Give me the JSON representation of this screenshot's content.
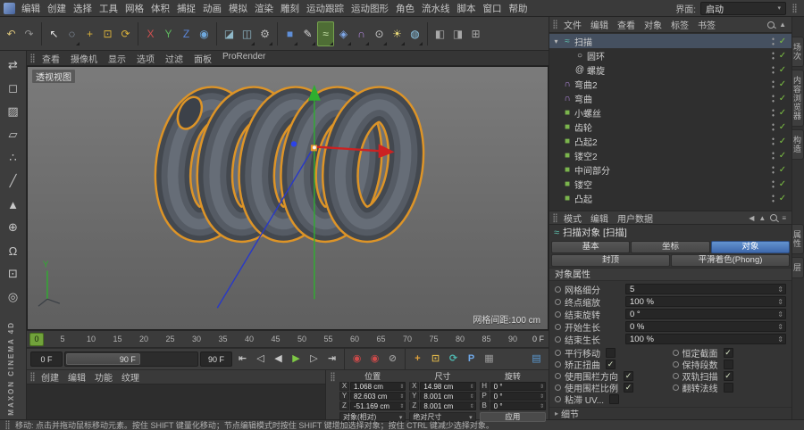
{
  "app": {
    "interface_label": "界面:",
    "interface_value": "启动"
  },
  "icons": {
    "check": "✓",
    "expander": "▾",
    "stepper": "⇕",
    "chevron_down": "▾",
    "triangle_right": "▸",
    "back": "◀",
    "up": "▲",
    "menu": "≡"
  },
  "menubar": {
    "items": [
      "编辑",
      "创建",
      "选择",
      "工具",
      "网格",
      "体积",
      "捕捉",
      "动画",
      "模拟",
      "渲染",
      "雕刻",
      "运动跟踪",
      "运动图形",
      "角色",
      "流水线",
      "脚本",
      "窗口",
      "帮助"
    ]
  },
  "toolbar": {
    "icons": [
      {
        "name": "undo",
        "glyph": "↶",
        "color": "#d9c37a"
      },
      {
        "name": "redo",
        "glyph": "↷",
        "color": "#909090"
      },
      {
        "sep": true
      },
      {
        "name": "live-selection",
        "glyph": "↖",
        "color": "#e6e6e6"
      },
      {
        "name": "selection-frame",
        "glyph": "◌",
        "color": "#b8cde8",
        "corner": true
      },
      {
        "name": "move-tool",
        "glyph": "+",
        "color": "#d9b13b"
      },
      {
        "name": "scale-tool",
        "glyph": "⊡",
        "color": "#d9b13b"
      },
      {
        "name": "rotate-tool",
        "glyph": "⟳",
        "color": "#d9b13b"
      },
      {
        "sep": true
      },
      {
        "name": "lock-x-axis",
        "glyph": "X",
        "color": "#d05050"
      },
      {
        "name": "lock-y-axis",
        "glyph": "Y",
        "color": "#5fb85f"
      },
      {
        "name": "lock-z-axis",
        "glyph": "Z",
        "color": "#5b86d8"
      },
      {
        "name": "coordinate-system",
        "glyph": "◉",
        "color": "#6fa8dc"
      },
      {
        "sep": true
      },
      {
        "name": "render-view",
        "glyph": "◪",
        "color": "#8fb8c8"
      },
      {
        "name": "render-picture-viewer",
        "glyph": "◫",
        "color": "#8fb8c8",
        "corner": true
      },
      {
        "name": "render-settings",
        "glyph": "⚙",
        "color": "#bababa",
        "corner": true
      },
      {
        "sep": true
      },
      {
        "name": "add-primitive-cube",
        "glyph": "■",
        "color": "#5f8fd8",
        "corner": true
      },
      {
        "name": "spline-pen",
        "glyph": "✎",
        "color": "#d8d8d8",
        "corner": true
      },
      {
        "name": "sweep-generator",
        "glyph": "≈",
        "color": "#cde8b0",
        "corner": true,
        "active": true
      },
      {
        "name": "subdivision-surface",
        "glyph": "◈",
        "color": "#7fa8e8",
        "corner": true
      },
      {
        "name": "bend-deformer",
        "glyph": "∩",
        "color": "#b48ae0",
        "corner": true
      },
      {
        "name": "camera",
        "glyph": "⊙",
        "color": "#c8c8c8",
        "corner": true
      },
      {
        "name": "light",
        "glyph": "☀",
        "color": "#e8d878",
        "corner": true
      },
      {
        "name": "sky",
        "glyph": "◍",
        "color": "#8fc8e8",
        "corner": true
      },
      {
        "sep": true
      },
      {
        "name": "layout-one",
        "glyph": "◧",
        "color": "#a8a8a8"
      },
      {
        "name": "layout-two",
        "glyph": "◨",
        "color": "#a8a8a8"
      },
      {
        "name": "layout-quad",
        "glyph": "⊞",
        "color": "#a8a8a8"
      }
    ]
  },
  "left_toolbar": {
    "brand": "MAXON CINEMA 4D",
    "icons": [
      {
        "name": "make-editable",
        "glyph": "⇄",
        "color": "#c8c8c8"
      },
      {
        "name": "model-mode",
        "glyph": "◻",
        "color": "#c8c8c8"
      },
      {
        "name": "texture-mode",
        "glyph": "▨",
        "color": "#c8c8c8"
      },
      {
        "name": "workplane-mode",
        "glyph": "▱",
        "color": "#c8c8c8"
      },
      {
        "name": "points-mode",
        "glyph": "∴",
        "color": "#c8c8c8"
      },
      {
        "name": "edges-mode",
        "glyph": "╱",
        "color": "#c8c8c8"
      },
      {
        "name": "polygons-mode",
        "glyph": "▲",
        "color": "#c8c8c8"
      },
      {
        "name": "axis-mode",
        "glyph": "⊕",
        "color": "#c8c8c8"
      },
      {
        "name": "snap-toggle",
        "glyph": "Ω",
        "color": "#c8c8c8"
      },
      {
        "name": "workplane-lock",
        "glyph": "⊡",
        "color": "#c8c8c8"
      },
      {
        "name": "viewport-filter",
        "glyph": "◎",
        "color": "#c8c8c8"
      }
    ]
  },
  "viewport": {
    "menu": [
      "查看",
      "摄像机",
      "显示",
      "选项",
      "过滤",
      "面板",
      "ProRender"
    ],
    "view_label": "透视视图",
    "grid_label": "网格间距:100 cm"
  },
  "timeline": {
    "ticks": [
      "0",
      "5",
      "10",
      "15",
      "20",
      "25",
      "30",
      "35",
      "40",
      "45",
      "50",
      "55",
      "60",
      "65",
      "70",
      "75",
      "80",
      "85",
      "90"
    ],
    "playhead": "0",
    "current_frame": "0 F"
  },
  "transport": {
    "current": "0 F",
    "range_handle": "90 F",
    "range_end": "90 F",
    "buttons": [
      {
        "name": "goto-start",
        "glyph": "⇤",
        "color": "#c8c8c8"
      },
      {
        "name": "previous-key",
        "glyph": "◁",
        "color": "#c8c8c8"
      },
      {
        "name": "previous-frame",
        "glyph": "◀",
        "color": "#c8c8c8"
      },
      {
        "name": "play",
        "glyph": "▶",
        "color": "#7ec845"
      },
      {
        "name": "next-frame",
        "glyph": "▷",
        "color": "#c8c8c8"
      },
      {
        "name": "goto-end",
        "glyph": "⇥",
        "color": "#c8c8c8"
      },
      {
        "sep": true
      },
      {
        "name": "record-keyframe",
        "glyph": "◉",
        "color": "#cf4a4a"
      },
      {
        "name": "autokeying",
        "glyph": "◉",
        "color": "#cf4a4a"
      },
      {
        "name": "keyframe-off",
        "glyph": "⊘",
        "color": "#9a9a9a"
      },
      {
        "sep": true
      },
      {
        "name": "key-position",
        "glyph": "+",
        "color": "#e0a23c"
      },
      {
        "name": "key-scale",
        "glyph": "⊡",
        "color": "#d8b14a"
      },
      {
        "name": "key-rotation",
        "glyph": "⟳",
        "color": "#4fb8b0"
      },
      {
        "name": "key-parameter",
        "glyph": "P",
        "color": "#6fa8e8"
      },
      {
        "name": "key-pla",
        "glyph": "▦",
        "color": "#9a9a9a"
      },
      {
        "name": "preview-render",
        "glyph": "▤",
        "color": "#5b9bd5",
        "end": true
      }
    ]
  },
  "materials": {
    "menu": [
      "创建",
      "编辑",
      "功能",
      "纹理"
    ]
  },
  "coord": {
    "columns": [
      {
        "header": "位置",
        "rows": [
          {
            "l": "X",
            "v": "1.068 cm"
          },
          {
            "l": "Y",
            "v": "82.603 cm"
          },
          {
            "l": "Z",
            "v": "-51.169 cm"
          }
        ],
        "footer": {
          "type": "select",
          "label": "对象(相对)"
        }
      },
      {
        "header": "尺寸",
        "rows": [
          {
            "l": "X",
            "v": "14.98 cm"
          },
          {
            "l": "Y",
            "v": "8.001 cm"
          },
          {
            "l": "Z",
            "v": "8.001 cm"
          }
        ],
        "footer": {
          "type": "select",
          "label": "绝对尺寸"
        }
      },
      {
        "header": "旋转",
        "rows": [
          {
            "l": "H",
            "v": "0 °"
          },
          {
            "l": "P",
            "v": "0 °"
          },
          {
            "l": "B",
            "v": "0 °"
          }
        ],
        "footer": {
          "type": "button",
          "label": "应用"
        }
      }
    ]
  },
  "object_manager": {
    "menu": [
      "文件",
      "编辑",
      "查看",
      "对象",
      "标签",
      "书签"
    ],
    "icon_glyphs": {
      "sweep": "≈",
      "circle": "○",
      "helix": "@",
      "bend": "∩",
      "object": "■"
    },
    "tree": [
      {
        "label": "扫描",
        "level": 0,
        "icon": "sweep",
        "expander": true,
        "check": true,
        "selected": true
      },
      {
        "label": "圆环",
        "level": 1,
        "icon": "circle",
        "check": true
      },
      {
        "label": "螺旋",
        "level": 1,
        "icon": "helix",
        "check": true
      },
      {
        "label": "弯曲2",
        "level": 0,
        "icon": "bend",
        "check": true
      },
      {
        "label": "弯曲",
        "level": 0,
        "icon": "bend",
        "check": true
      },
      {
        "label": "小螺丝",
        "level": 0,
        "icon": "object",
        "check": true
      },
      {
        "label": "齿轮",
        "level": 0,
        "icon": "object",
        "check": true
      },
      {
        "label": "凸起2",
        "level": 0,
        "icon": "object",
        "check": true
      },
      {
        "label": "镂空2",
        "level": 0,
        "icon": "object",
        "check": true
      },
      {
        "label": "中间部分",
        "level": 0,
        "icon": "object",
        "check": true
      },
      {
        "label": "镂空",
        "level": 0,
        "icon": "object",
        "check": true
      },
      {
        "label": "凸起",
        "level": 0,
        "icon": "object",
        "check": true
      }
    ]
  },
  "attributes": {
    "menu": [
      "模式",
      "编辑",
      "用户数据"
    ],
    "title": "扫描对象 [扫描]",
    "tabs_row1": [
      "基本",
      "坐标",
      "对象"
    ],
    "tabs_row2": [
      "封顶",
      "平滑着色(Phong)"
    ],
    "active_tab": "对象",
    "section": "对象属性",
    "fields": [
      {
        "label": "网格细分",
        "value": "5"
      },
      {
        "label": "终点缩放",
        "value": "100 %"
      },
      {
        "label": "结束旋转",
        "value": "0 °"
      },
      {
        "label": "开始生长",
        "value": "0 %"
      },
      {
        "label": "结束生长",
        "value": "100 %"
      }
    ],
    "checks_left": [
      {
        "label": "平行移动",
        "checked": false
      },
      {
        "label": "矫正扭曲",
        "checked": true
      },
      {
        "label": "使用围栏方向",
        "checked": true
      },
      {
        "label": "使用围栏比例",
        "checked": true
      },
      {
        "label": "粘滞 UV...",
        "checked": false
      }
    ],
    "checks_right": [
      {
        "label": "恒定截面",
        "checked": true
      },
      {
        "label": "保持段数",
        "checked": false
      },
      {
        "label": "双轨扫描",
        "checked": true
      },
      {
        "label": "翻转法线",
        "checked": false
      }
    ],
    "details_label": "细节"
  },
  "edge_tabs": {
    "top": [
      "场次",
      "内容浏览器",
      "构造"
    ],
    "bottom": [
      "属性",
      "层"
    ]
  },
  "statusbar": {
    "text": "移动: 点击并拖动鼠标移动元素。按住 SHIFT 键量化移动；节点编辑模式时按住 SHIFT 键增加选择对象；按住 CTRL 键减少选择对象。"
  }
}
